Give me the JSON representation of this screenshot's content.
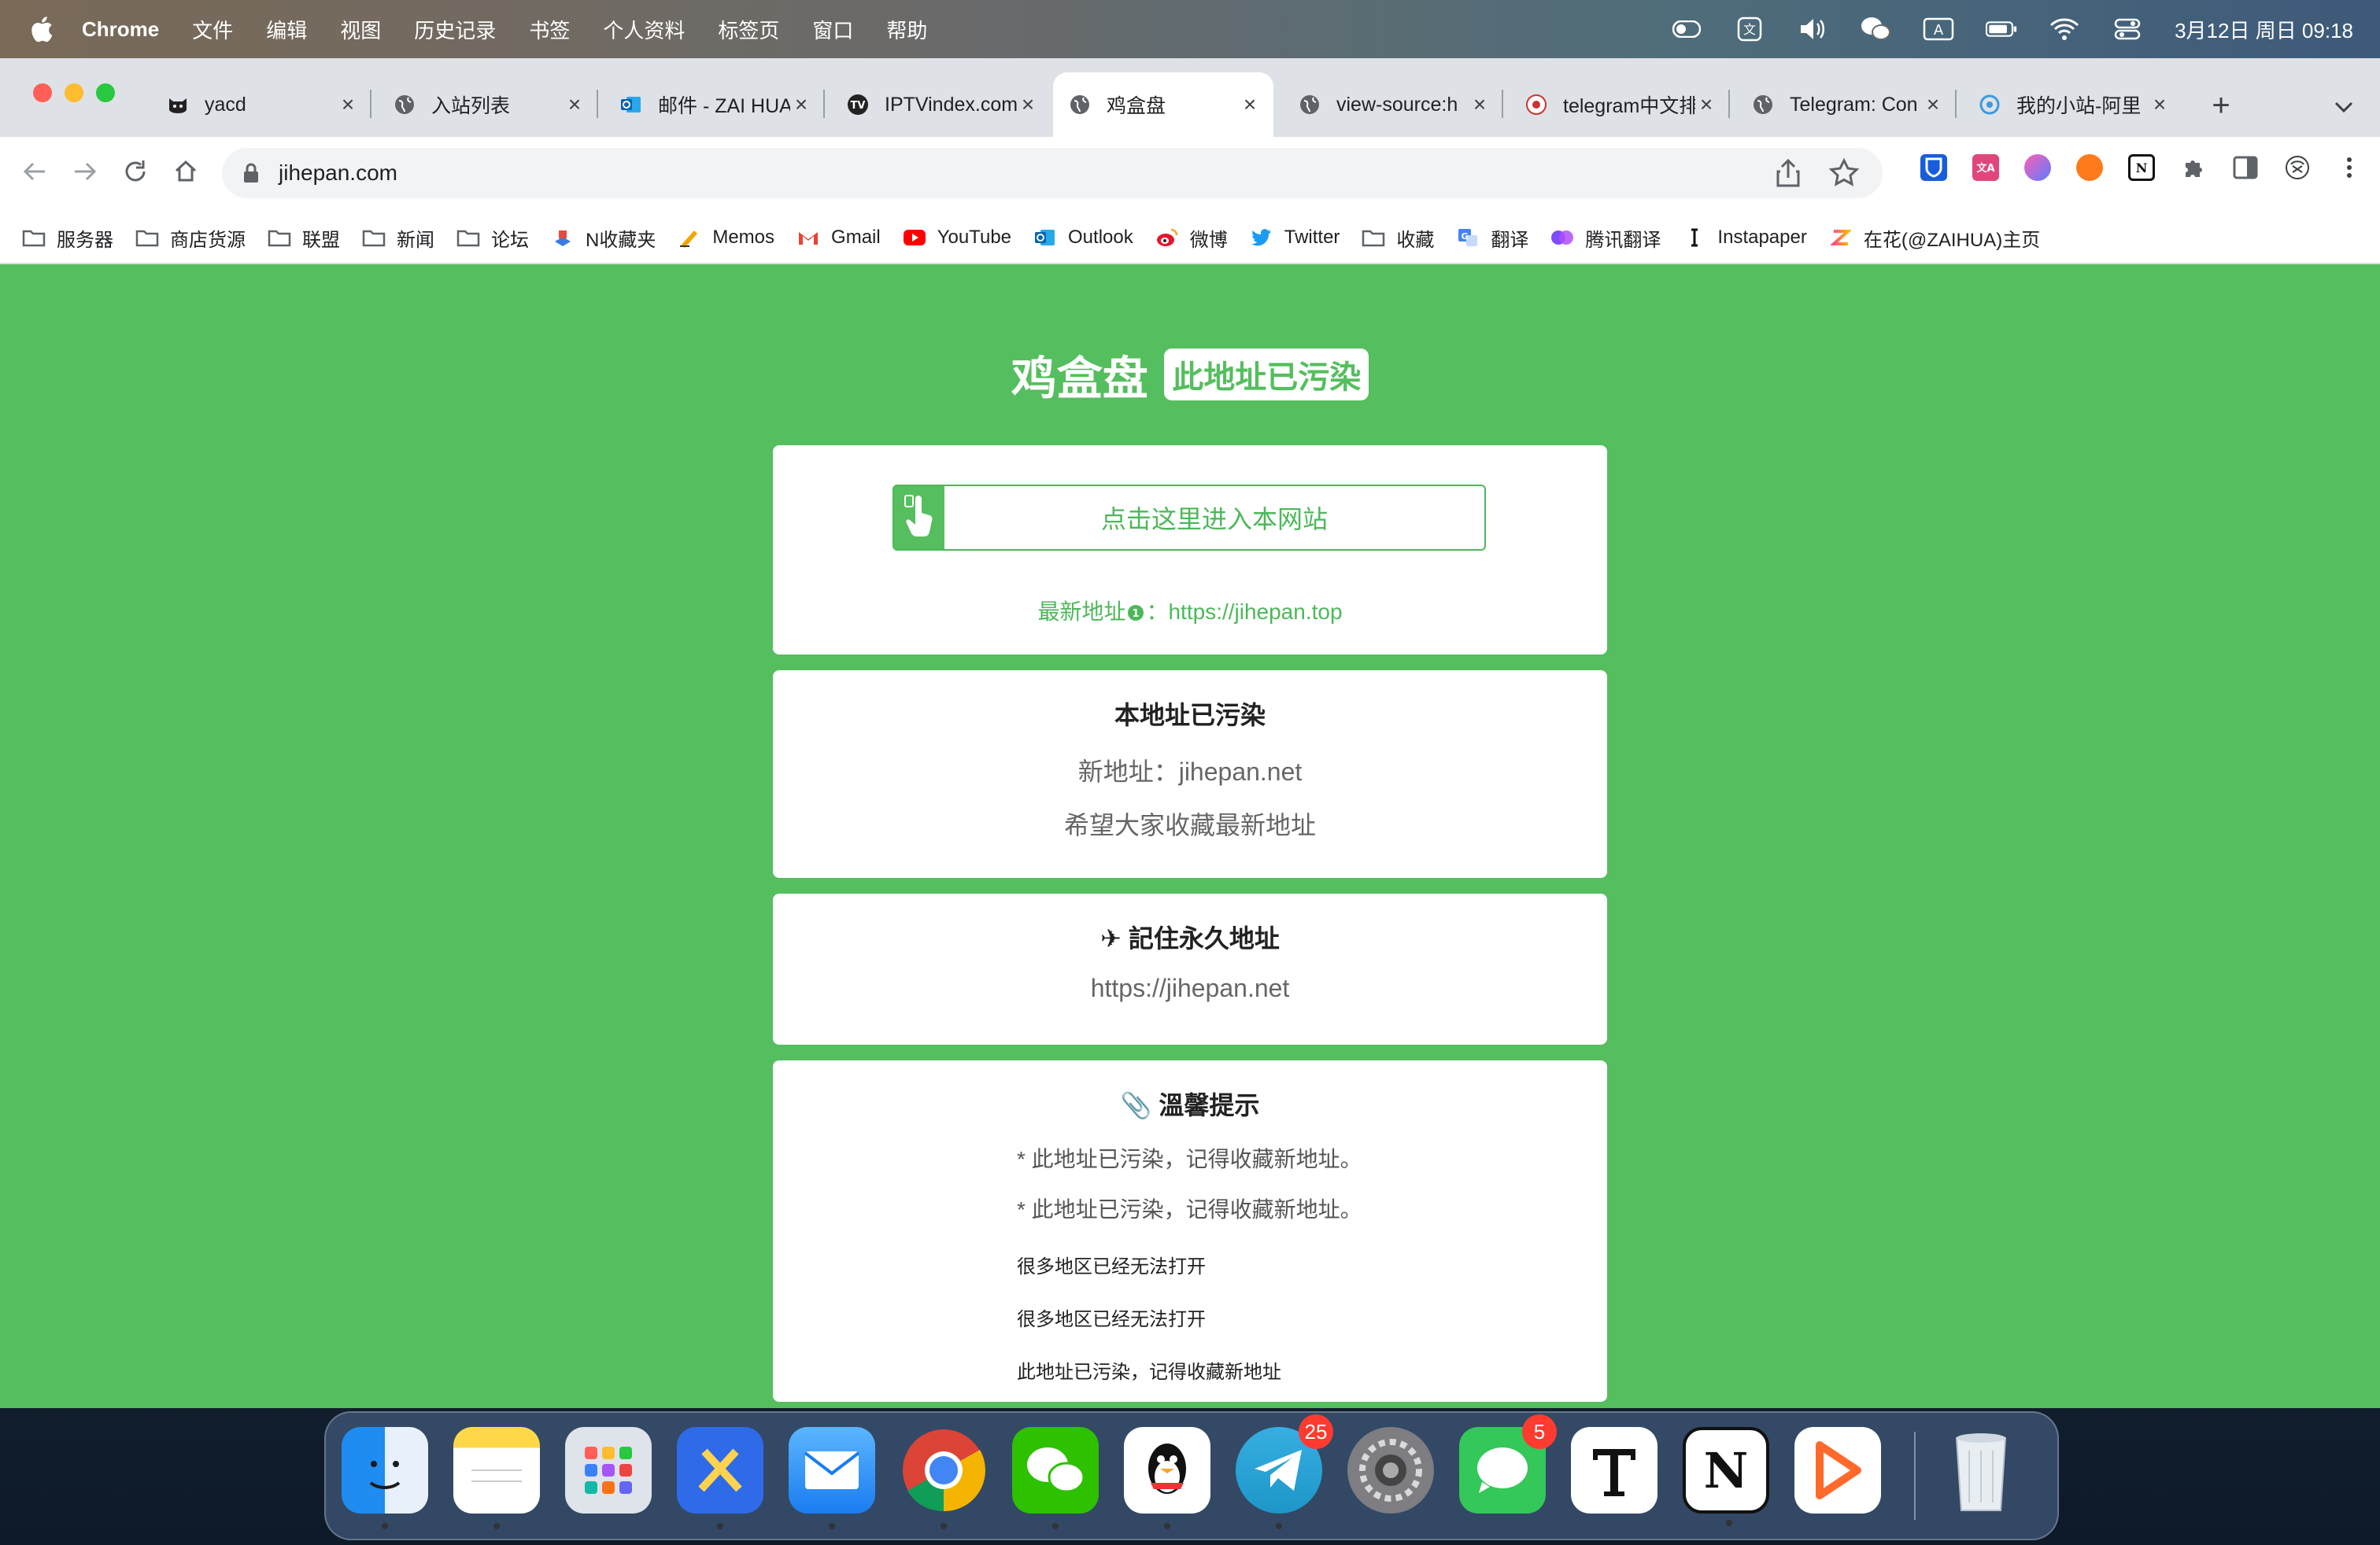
{
  "menubar": {
    "app": "Chrome",
    "items": [
      "文件",
      "编辑",
      "视图",
      "历史记录",
      "书签",
      "个人资料",
      "标签页",
      "窗口",
      "帮助"
    ],
    "clock": "3月12日 周日  09:18",
    "input_method": "A"
  },
  "tabs": [
    {
      "title": "yacd",
      "icon": "cat-icon"
    },
    {
      "title": "入站列表",
      "icon": "globe-icon"
    },
    {
      "title": "邮件 - ZAI HUA",
      "icon": "outlook-icon"
    },
    {
      "title": "IPTVindex.com",
      "icon": "iptv-icon"
    },
    {
      "title": "鸡盒盘",
      "icon": "globe-icon",
      "active": true
    },
    {
      "title": "view-source:h",
      "icon": "globe-icon"
    },
    {
      "title": "telegram中文排",
      "icon": "telegram-cn-icon"
    },
    {
      "title": "Telegram: Con",
      "icon": "globe-icon"
    },
    {
      "title": "我的小站-阿里",
      "icon": "site-icon"
    }
  ],
  "toolbar": {
    "url": "jihepan.com"
  },
  "bookmarks": [
    {
      "label": "服务器",
      "icon": "folder-icon"
    },
    {
      "label": "商店货源",
      "icon": "folder-icon"
    },
    {
      "label": "联盟",
      "icon": "folder-icon"
    },
    {
      "label": "新闻",
      "icon": "folder-icon"
    },
    {
      "label": "论坛",
      "icon": "folder-icon"
    },
    {
      "label": "N收藏夹",
      "icon": "bookmark-n-icon"
    },
    {
      "label": "Memos",
      "icon": "memos-icon"
    },
    {
      "label": "Gmail",
      "icon": "gmail-icon"
    },
    {
      "label": "YouTube",
      "icon": "youtube-icon"
    },
    {
      "label": "Outlook",
      "icon": "outlook-icon"
    },
    {
      "label": "微博",
      "icon": "weibo-icon"
    },
    {
      "label": "Twitter",
      "icon": "twitter-icon"
    },
    {
      "label": "收藏",
      "icon": "folder-icon"
    },
    {
      "label": "翻译",
      "icon": "translate-icon"
    },
    {
      "label": "腾讯翻译",
      "icon": "tencent-translate-icon"
    },
    {
      "label": "Instapaper",
      "icon": "instapaper-icon"
    },
    {
      "label": "在花(@ZAIHUA)主页",
      "icon": "zaihua-icon"
    }
  ],
  "page": {
    "site_name": "鸡盒盘",
    "site_tag": "此地址已污染",
    "enter_button": "点击这里进入本网站",
    "newest_label": "最新地址",
    "newest_sep": "：",
    "newest_url": "https://jihepan.top",
    "card2": {
      "heading": "本地址已污染",
      "line1": "新地址：jihepan.net",
      "line2": "希望大家收藏最新地址"
    },
    "card3": {
      "heading": "✈ 記住永久地址",
      "url": "https://jihepan.net"
    },
    "card4": {
      "heading": "📎 溫馨提示",
      "tips": [
        "* 此地址已污染，记得收藏新地址。",
        "* 此地址已污染，记得收藏新地址。"
      ],
      "notes": [
        "很多地区已经无法打开",
        "很多地区已经无法打开",
        "此地址已污染，记得收藏新地址"
      ]
    }
  },
  "dock": {
    "telegram_badge": "25",
    "messages_badge": "5"
  },
  "colors": {
    "page_green": "#55be5e",
    "accent_green": "#4cb85a"
  }
}
